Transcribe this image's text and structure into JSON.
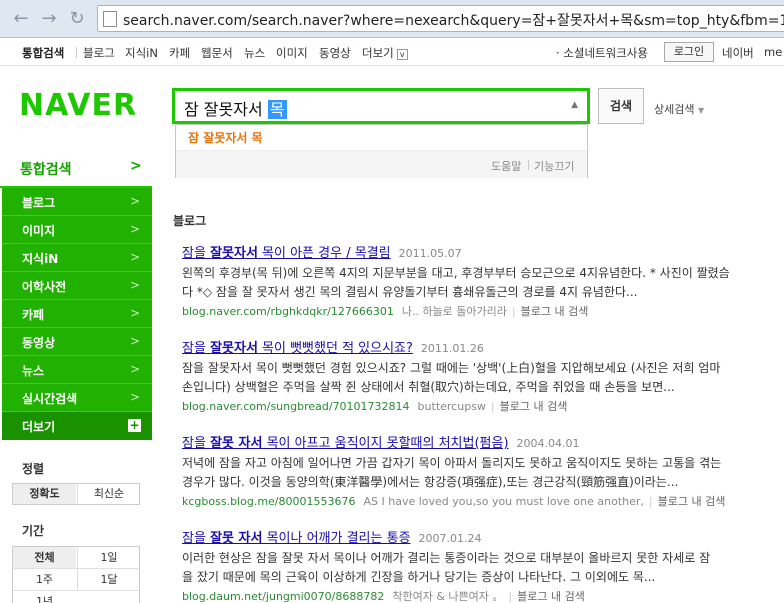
{
  "browser": {
    "url": "search.naver.com/search.naver?where=nexearch&query=잠+잘못자서+목&sm=top_hty&fbm=1&"
  },
  "topnav": {
    "items": [
      "통합검색",
      "블로그",
      "지식iN",
      "카페",
      "웹문서",
      "뉴스",
      "이미지",
      "동영상",
      "더보기"
    ],
    "social": "· 소셜네트워크사용",
    "login": "로그인",
    "naverme": "네이버",
    "me": "me"
  },
  "header": {
    "logo": "NAVER",
    "query": "잠 잘못자서 ",
    "query_selected": "목",
    "search_button": "검색",
    "detail_search": "상세검색"
  },
  "autocomplete": {
    "suggestion": "잠 잘못자서 목",
    "help": "도움말",
    "toggle": "기능끄기"
  },
  "sidebar": {
    "integrated": "통합검색",
    "items": [
      "블로그",
      "이미지",
      "지식iN",
      "어학사전",
      "카페",
      "동영상",
      "뉴스",
      "실시간검색"
    ],
    "more": "더보기",
    "sort_title": "정렬",
    "sort_options": [
      "정확도",
      "최신순"
    ],
    "period_title": "기간",
    "period_options": [
      [
        "전체",
        "1일"
      ],
      [
        "1주",
        "1달"
      ],
      [
        "1년",
        ""
      ]
    ]
  },
  "main": {
    "section": "블로그",
    "results": [
      {
        "title_pre": "잠을 ",
        "title_kw": "잘못자서",
        "title_post": " 목이 아픈 경우 / 목결림",
        "date": "2011.05.07",
        "desc1": "왼쪽의 후경부(목 뒤)에 오른쪽 4지의 지문부분을 대고, 후경부부터 승모근으로 4지유념한다. * 사진이 짤렸슴",
        "desc2": "다 *◇ 잠을 잘 못자서 생긴 목의 결림시 유양돌기부터 흉쇄유돌근의 경로를 4지 유념한다...",
        "url": "blog.naver.com/rbghkdqkr/127666301",
        "author": "나.. 하늘로 돌아가리라",
        "inblog": "블로그 내 검색"
      },
      {
        "title_pre": "잠을 ",
        "title_kw": "잘못자서",
        "title_post": " 목이 뻣뻣했던 적 있으시죠?",
        "date": "2011.01.26",
        "desc1": "잠을 잘못자서 목이 뻣뻣했던 경험 있으시죠? 그럴 때에는 '상백'(上白)혈을 지압해보세요 (사진은 저희 엄마",
        "desc2": "손입니다) 상백혈은 주먹을 살짝 쥔 상태에서 취혈(取穴)하는데요, 주먹을 쥐었을 때 손등을 보면...",
        "url": "blog.naver.com/sungbread/70101732814",
        "author": "buttercupsw",
        "inblog": "블로그 내 검색"
      },
      {
        "title_pre": "잠을 ",
        "title_kw": "잘못 자서",
        "title_post": " 목이 아프고 움직이지 못할때의 처치법(펌음)",
        "date": "2004.04.01",
        "desc1": "저녁에 잠을 자고 아침에 일어나면 가끔 갑자기 목이 아파서 돌리지도 못하고 움직이지도 못하는 고통을 겪는",
        "desc2": "경우가 많다. 이것을 동양의학(東洋醫學)에서는 항강증(項强症),또는 경근강직(頸筋强直)이라는...",
        "url": "kcgboss.blog.me/80001553676",
        "author": "AS I have loved you,so you must love one another,",
        "inblog": "블로그 내 검색"
      },
      {
        "title_pre": "잠을 ",
        "title_kw": "잘못 자서",
        "title_post": " 목이나 어깨가 결리는 통증",
        "date": "2007.01.24",
        "desc1": "이러한 현상은 잠을 잘못 자서 목이나 어깨가 결리는 통증이라는 것으로 대부분이 올바르지 못한 자세로 잠",
        "desc2": "을 잤기 때문에 목의 근육이 이상하게 긴장을 하거나 당기는 증상이 나타난다. 그 이외에도 목...",
        "url": "blog.daum.net/jungmi0070/8688782",
        "author": "착한여자 & 나쁜여자 。",
        "inblog": "블로그 내 검색"
      }
    ]
  },
  "colors": {
    "naver_green": "#1ec800",
    "sidebar_green": "#21b100",
    "link": "#1a0dab",
    "url_green": "#2a8b32",
    "suggest_orange": "#e7730a"
  }
}
